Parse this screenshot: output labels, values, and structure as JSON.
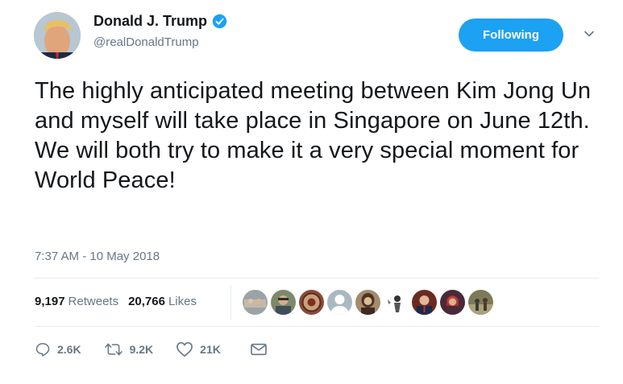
{
  "author": {
    "name": "Donald J. Trump",
    "handle": "@realDonaldTrump",
    "verified_icon": "verified-badge-icon",
    "avatar_icon": "profile-avatar"
  },
  "follow_button": {
    "label": "Following"
  },
  "tweet": {
    "text": "The highly anticipated meeting between Kim Jong Un and myself will take place in Singapore on June 12th. We will both try to make it a very special moment for World Peace!",
    "timestamp": "7:37 AM - 10 May 2018"
  },
  "stats": {
    "retweets_count": "9,197",
    "retweets_label": "Retweets",
    "likes_count": "20,766",
    "likes_label": "Likes"
  },
  "likers": [
    {
      "icon": "liker-avatar-1",
      "color": "#9aa3a8"
    },
    {
      "icon": "liker-avatar-2",
      "color": "#7b8a6a"
    },
    {
      "icon": "liker-avatar-3",
      "color": "#8a4a3a"
    },
    {
      "icon": "liker-avatar-4",
      "color": "#aab8c2"
    },
    {
      "icon": "liker-avatar-5",
      "color": "#a48a6e"
    },
    {
      "icon": "liker-avatar-6",
      "color": "#ffffff"
    },
    {
      "icon": "liker-avatar-7",
      "color": "#6a2a22"
    },
    {
      "icon": "liker-avatar-8",
      "color": "#4a2a3a"
    },
    {
      "icon": "liker-avatar-9",
      "color": "#7d7a5a"
    }
  ],
  "actions": {
    "reply_count": "2.6K",
    "retweet_count": "9.2K",
    "like_count": "21K",
    "reply_icon": "reply-icon",
    "retweet_icon": "retweet-icon",
    "like_icon": "heart-icon",
    "message_icon": "direct-message-icon"
  },
  "colors": {
    "accent": "#1da1f2",
    "secondary_text": "#657786",
    "divider": "#e6ecf0"
  }
}
